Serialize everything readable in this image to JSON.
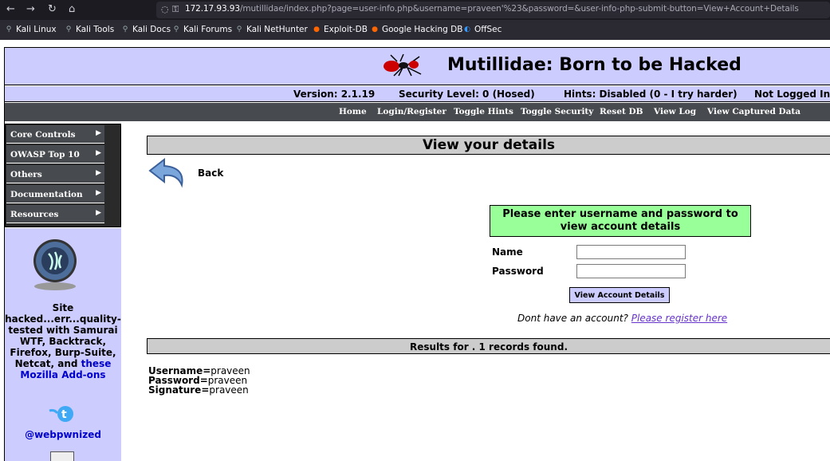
{
  "browser": {
    "url_host": "172.17.93.93",
    "url_rest": "/mutillidae/index.php?page=user-info.php&username=praveen'%23&password=&user-info-php-submit-button=View+Account+Details",
    "bookmarks": [
      {
        "label": "Kali Linux",
        "icon": "kali-dragon-icon"
      },
      {
        "label": "Kali Tools",
        "icon": "kali-dragon-icon"
      },
      {
        "label": "Kali Docs",
        "icon": "kali-dragon-icon"
      },
      {
        "label": "Kali Forums",
        "icon": "kali-dragon-icon"
      },
      {
        "label": "Kali NetHunter",
        "icon": "kali-dragon-icon"
      },
      {
        "label": "Exploit-DB",
        "icon": "exploit-db-icon"
      },
      {
        "label": "Google Hacking DB",
        "icon": "exploit-db-icon"
      },
      {
        "label": "OffSec",
        "icon": "offsec-icon"
      }
    ]
  },
  "header": {
    "title": "Mutillidae: Born to be Hacked",
    "version": "Version: 2.1.19",
    "security": "Security Level: 0 (Hosed)",
    "hints": "Hints: Disabled (0 - I try harder)",
    "login_status": "Not Logged In"
  },
  "menu": {
    "items": [
      "Home",
      "Login/Register",
      "Toggle Hints",
      "Toggle Security",
      "Reset DB",
      "View Log",
      "View Captured Data"
    ]
  },
  "sidebar": {
    "items": [
      "Core Controls",
      "OWASP Top 10",
      "Others",
      "Documentation",
      "Resources"
    ],
    "site_text_1": "Site hacked...err...quality-tested with Samurai WTF, Backtrack, Firefox, Burp-Suite, Netcat, and",
    "site_text_link": "these Mozilla Add-ons",
    "twitter": "@webpwnized"
  },
  "main": {
    "title": "View your details",
    "back_label": "Back",
    "form_header": "Please enter username and password to view account details",
    "name_label": "Name",
    "password_label": "Password",
    "name_value": "",
    "password_value": "",
    "submit_label": "View Account Details",
    "register_prefix": "Dont have an account?",
    "register_link": "Please register here",
    "results_title": "Results for . 1 records found.",
    "results": [
      {
        "key": "Username=",
        "value": "praveen"
      },
      {
        "key": "Password=",
        "value": "praveen"
      },
      {
        "key": "Signature=",
        "value": "praveen"
      }
    ]
  },
  "colors": {
    "header_band": "#ccccff",
    "menu_bar": "#474a4e",
    "form_header": "#99ff99",
    "link": "#6633cc"
  }
}
